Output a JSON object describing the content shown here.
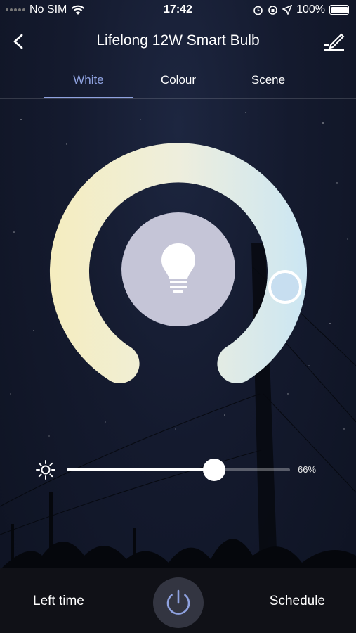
{
  "status_bar": {
    "carrier": "No SIM",
    "time": "17:42",
    "battery": "100%"
  },
  "header": {
    "title": "Lifelong 12W Smart Bulb"
  },
  "tabs": [
    {
      "label": "White",
      "active": true
    },
    {
      "label": "Colour",
      "active": false
    },
    {
      "label": "Scene",
      "active": false
    }
  ],
  "brightness": {
    "value": 0.66,
    "label": "66%"
  },
  "bottom": {
    "left_time_label": "Left time",
    "schedule_label": "Schedule"
  },
  "icons": {
    "back": "chevron-left-icon",
    "edit": "edit-icon",
    "bulb": "bulb-icon",
    "brightness": "sun-icon",
    "power": "power-icon",
    "wifi": "wifi-icon",
    "alarm": "alarm-icon",
    "location": "location-arrow-icon"
  },
  "colors": {
    "accent": "#8fa2e0",
    "warm": "#f5edbf",
    "cool": "#cbe6f3",
    "center_disc": "#c5c5d7"
  }
}
